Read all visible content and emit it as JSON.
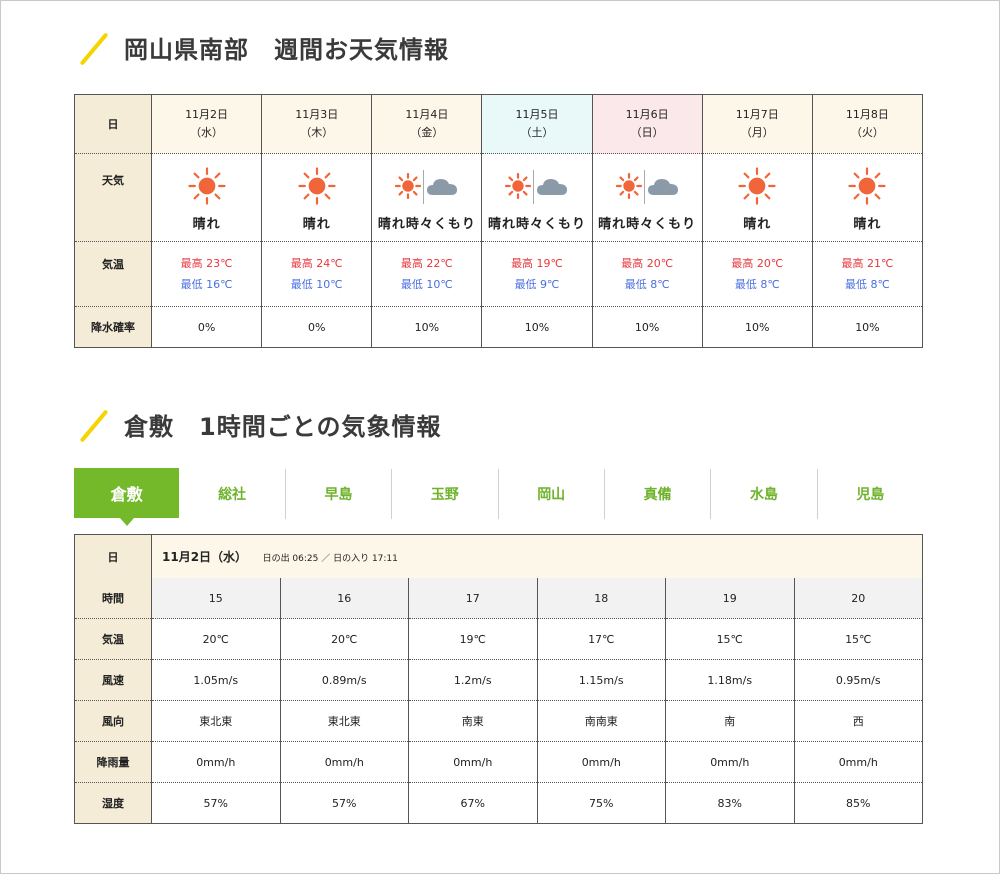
{
  "section1": {
    "title": "岡山県南部　週間お天気情報"
  },
  "weekly": {
    "row_labels": {
      "date": "日",
      "weather": "天気",
      "temp": "気温",
      "rain": "降水確率"
    },
    "days": [
      {
        "date": "11月2日",
        "dow": "（水）",
        "type": "weekday",
        "weather": "晴れ",
        "icon": "sun-icon",
        "hi": "最高 23℃",
        "lo": "最低 16℃",
        "rain": "0%"
      },
      {
        "date": "11月3日",
        "dow": "（木）",
        "type": "weekday",
        "weather": "晴れ",
        "icon": "sun-icon",
        "hi": "最高 24℃",
        "lo": "最低 10℃",
        "rain": "0%"
      },
      {
        "date": "11月4日",
        "dow": "（金）",
        "type": "weekday",
        "weather": "晴れ時々くもり",
        "icon": "sun-cloud-icon",
        "hi": "最高 22℃",
        "lo": "最低 10℃",
        "rain": "10%"
      },
      {
        "date": "11月5日",
        "dow": "（土）",
        "type": "sat",
        "weather": "晴れ時々くもり",
        "icon": "sun-cloud-icon",
        "hi": "最高 19℃",
        "lo": "最低 9℃",
        "rain": "10%"
      },
      {
        "date": "11月6日",
        "dow": "（日）",
        "type": "sun",
        "weather": "晴れ時々くもり",
        "icon": "sun-cloud-icon",
        "hi": "最高 20℃",
        "lo": "最低 8℃",
        "rain": "10%"
      },
      {
        "date": "11月7日",
        "dow": "（月）",
        "type": "weekday",
        "weather": "晴れ",
        "icon": "sun-icon",
        "hi": "最高 20℃",
        "lo": "最低 8℃",
        "rain": "10%"
      },
      {
        "date": "11月8日",
        "dow": "（火）",
        "type": "weekday",
        "weather": "晴れ",
        "icon": "sun-icon",
        "hi": "最高 21℃",
        "lo": "最低 8℃",
        "rain": "10%"
      }
    ]
  },
  "section2": {
    "title": "倉敷　1時間ごとの気象情報"
  },
  "tabs": [
    {
      "label": "倉敷",
      "active": true
    },
    {
      "label": "総社"
    },
    {
      "label": "早島"
    },
    {
      "label": "玉野"
    },
    {
      "label": "岡山"
    },
    {
      "label": "真備"
    },
    {
      "label": "水島"
    },
    {
      "label": "児島"
    }
  ],
  "hourly": {
    "day_label": "日",
    "date": "11月2日（水）",
    "sun_info": "日の出 06:25 ／ 日の入り 17:11",
    "rows": [
      {
        "label": "時間",
        "values": [
          "15",
          "16",
          "17",
          "18",
          "19",
          "20"
        ]
      },
      {
        "label": "気温",
        "values": [
          "20℃",
          "20℃",
          "19℃",
          "17℃",
          "15℃",
          "15℃"
        ]
      },
      {
        "label": "風速",
        "values": [
          "1.05m/s",
          "0.89m/s",
          "1.2m/s",
          "1.15m/s",
          "1.18m/s",
          "0.95m/s"
        ]
      },
      {
        "label": "風向",
        "values": [
          "東北東",
          "東北東",
          "南東",
          "南南東",
          "南",
          "西"
        ]
      },
      {
        "label": "降雨量",
        "values": [
          "0mm/h",
          "0mm/h",
          "0mm/h",
          "0mm/h",
          "0mm/h",
          "0mm/h"
        ]
      },
      {
        "label": "湿度",
        "values": [
          "57%",
          "57%",
          "67%",
          "75%",
          "83%",
          "85%"
        ]
      }
    ]
  },
  "colors": {
    "accent_green": "#74b92a",
    "slash_yellow": "#f5d400",
    "hi_red": "#e8373c",
    "lo_blue": "#4a6fe0",
    "header_beige": "#f5ecd7"
  }
}
